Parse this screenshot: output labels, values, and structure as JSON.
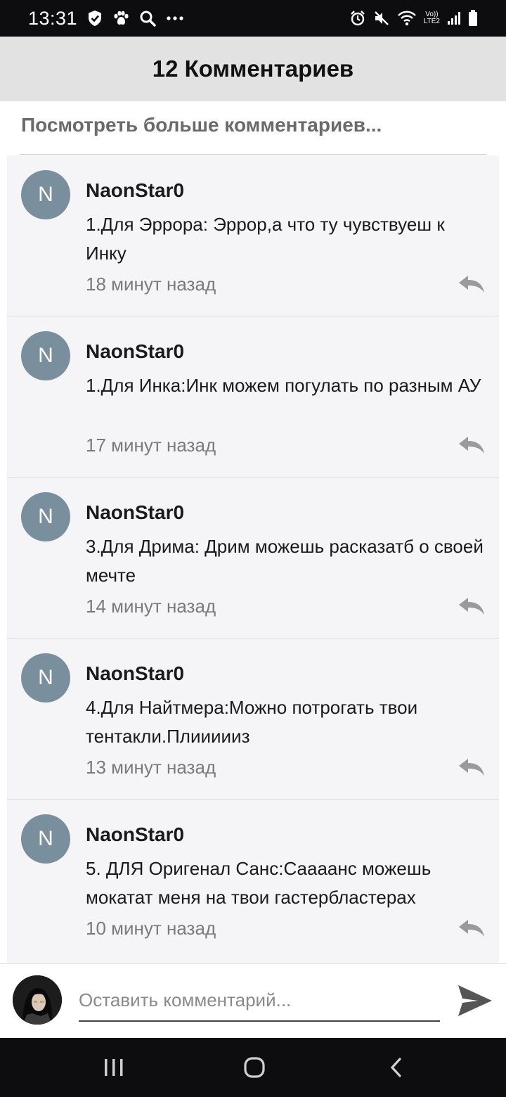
{
  "status_bar": {
    "time": "13:31",
    "lte_label_top": "Vo))",
    "lte_label_bottom": "LTE2"
  },
  "header": {
    "title": "12 Комментариев"
  },
  "more_comments": "Посмотреть больше комментариев...",
  "comments": [
    {
      "initial": "N",
      "author": "NaonStar0",
      "text": "1.Для Эррора: Эррор,а что ту чувствуеш к Инку",
      "time": "18 минут назад"
    },
    {
      "initial": "N",
      "author": "NaonStar0",
      "text": "1.Для Инка:Инк можем погулать по разным АУ",
      "time": "17 минут назад"
    },
    {
      "initial": "N",
      "author": "NaonStar0",
      "text": "3.Для Дрима: Дрим можешь расказатб о своей мечте",
      "time": "14 минут назад"
    },
    {
      "initial": "N",
      "author": "NaonStar0",
      "text": "4.Для Найтмера:Можно потрогать твои тентакли.Плиииииз",
      "time": "13 минут назад"
    },
    {
      "initial": "N",
      "author": "NaonStar0",
      "text": "5. ДЛЯ Оригенал Санс:Саааанс можешь мокатат меня на твои гастербластерах",
      "time": "10 минут назад"
    }
  ],
  "composer": {
    "placeholder": "Оставить комментарий..."
  },
  "colors": {
    "avatar": "#7a8f9e",
    "header_bg": "#e2e2e2",
    "list_bg": "#f5f5f7",
    "system_bar": "#0d0d0f"
  }
}
